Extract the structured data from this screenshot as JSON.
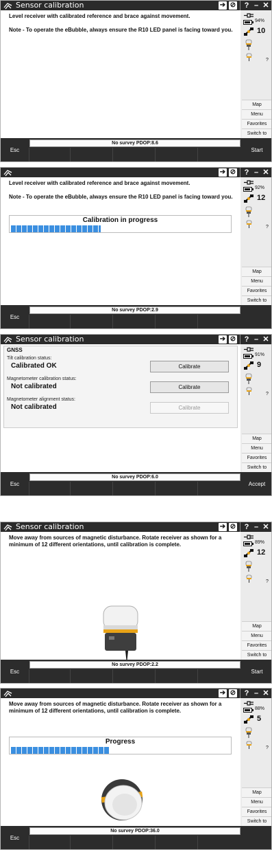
{
  "panels": [
    {
      "title": "Sensor calibration",
      "message": [
        "Level receiver with calibrated reference and brace against movement.",
        "Note - To operate the eBubble, always ensure the R10 LED panel is facing toward you."
      ],
      "battery_pct": "94%",
      "battery_level": 0.94,
      "satellites": "10",
      "status": "No survey  PDOP:8.6",
      "left_button": "Esc",
      "right_button": "Start"
    },
    {
      "title": "",
      "message": [
        "Level receiver with calibrated reference and brace against movement.",
        "Note - To operate the eBubble, always ensure the R10 LED panel is facing toward you."
      ],
      "progress_label": "Calibration in progress",
      "progress": 0.41,
      "battery_pct": "92%",
      "battery_level": 0.92,
      "satellites": "12",
      "status": "No survey  PDOP:2.9",
      "left_button": "Esc",
      "right_button": ""
    },
    {
      "title": "Sensor calibration",
      "gnss": {
        "heading": "GNSS",
        "rows": [
          {
            "label": "Tilt calibration status:",
            "value": "Calibrated OK",
            "button": "Calibrate",
            "enabled": true
          },
          {
            "label": "Magnetometer calibration status:",
            "value": "Not calibrated",
            "button": "Calibrate",
            "enabled": true
          },
          {
            "label": "Magnetometer alignment status:",
            "value": "Not calibrated",
            "button": "Calibrate",
            "enabled": false
          }
        ]
      },
      "battery_pct": "91%",
      "battery_level": 0.91,
      "satellites": "9",
      "status": "No survey  PDOP:6.0",
      "left_button": "Esc",
      "right_button": "Accept"
    },
    {
      "title": "Sensor calibration",
      "message": [
        "Move away from sources of magnetic disturbance. Rotate receiver as shown for a minimum of 12 different orientations, until calibration is complete."
      ],
      "battery_pct": "89%",
      "battery_level": 0.89,
      "satellites": "12",
      "status": "No survey  PDOP:2.2",
      "left_button": "Esc",
      "right_button": "Start"
    },
    {
      "title": "",
      "message": [
        "Move away from sources of magnetic disturbance. Rotate receiver as shown for a minimum of 12 different orientations, until calibration is complete."
      ],
      "progress_label": "Progress",
      "progress": 0.45,
      "battery_pct": "88%",
      "battery_level": 0.88,
      "satellites": "5",
      "status": "No survey  PDOP:36.0",
      "left_button": "Esc",
      "right_button": ""
    }
  ],
  "window_buttons": {
    "help": "?",
    "minimize": "–",
    "close": "✕"
  },
  "unknown_mark": "?",
  "side_menu": [
    "Map",
    "Menu",
    "Favorites",
    "Switch to"
  ],
  "icons": {
    "logo": "trimble-logo-icon",
    "login": "arrow-into-icon",
    "no_entry": "no-entry-icon",
    "plug": "power-plug-icon",
    "battery": "battery-icon",
    "satellite": "satellite-icon",
    "receiver": "gnss-receiver-icon",
    "receiver_small": "gnss-receiver-small-icon"
  },
  "colors": {
    "progress_fill": "#3b8fe0",
    "title_bar": "#2b2b2b",
    "bottom_bar": "#2c2c2c",
    "receiver_accent": "#e8a317"
  }
}
